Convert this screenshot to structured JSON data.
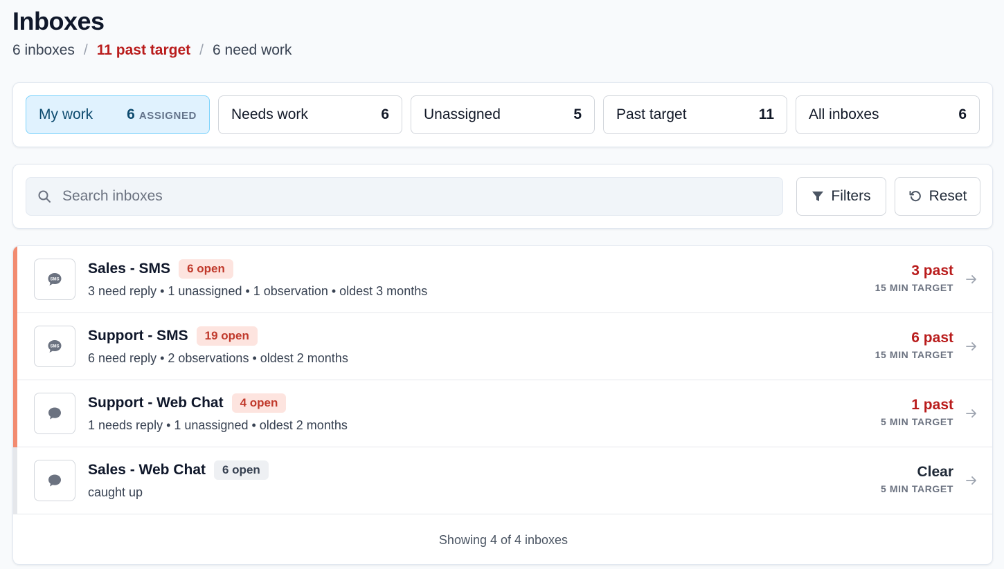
{
  "header": {
    "title": "Inboxes",
    "summary": {
      "inboxes": "6 inboxes",
      "past_target": "11 past target",
      "need_work": "6 need work"
    }
  },
  "tabs": [
    {
      "label": "My work",
      "count": "6",
      "suffix": "ASSIGNED",
      "active": true
    },
    {
      "label": "Needs work",
      "count": "6"
    },
    {
      "label": "Unassigned",
      "count": "5"
    },
    {
      "label": "Past target",
      "count": "11"
    },
    {
      "label": "All inboxes",
      "count": "6"
    }
  ],
  "search": {
    "placeholder": "Search inboxes",
    "value": ""
  },
  "toolbar": {
    "filters_label": "Filters",
    "reset_label": "Reset"
  },
  "inboxes": [
    {
      "name": "Sales - SMS",
      "badge": "6 open",
      "meta": "3 need reply • 1 unassigned • 1 observation • oldest 3 months",
      "status": "3 past",
      "target": "15 MIN TARGET",
      "icon": "sms-icon"
    },
    {
      "name": "Support - SMS",
      "badge": "19 open",
      "meta": "6 need reply • 2 observations • oldest 2 months",
      "status": "6 past",
      "target": "15 MIN TARGET",
      "icon": "sms-icon"
    },
    {
      "name": "Support - Web Chat",
      "badge": "4 open",
      "meta": "1 needs reply • 1 unassigned • oldest 2 months",
      "status": "1 past",
      "target": "5 MIN TARGET",
      "icon": "chat-bubble-icon"
    },
    {
      "name": "Sales - Web Chat",
      "badge": "6 open",
      "meta": "caught up",
      "status": "Clear",
      "target": "5 MIN TARGET",
      "icon": "chat-bubble-icon"
    }
  ],
  "footer": {
    "text": "Showing 4 of 4 inboxes"
  },
  "colors": {
    "alert": "#f28b70",
    "danger": "#b91c1c",
    "active_tab_bg": "#e0f2fe"
  }
}
